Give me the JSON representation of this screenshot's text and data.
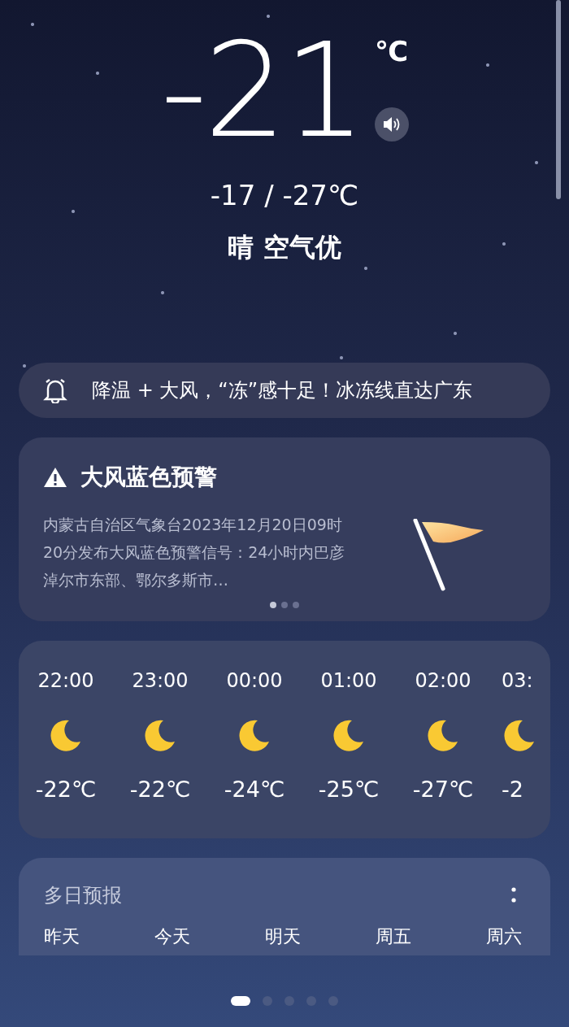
{
  "current": {
    "temperature": "-21",
    "unit": "℃",
    "range": "-17 / -27℃",
    "condition": "晴 空气优"
  },
  "news": {
    "text": "降温 + 大风，“冻”感十足！冰冻线直达广东"
  },
  "warning": {
    "title": "大风蓝色预警",
    "body": "内蒙古自治区气象台2023年12月20日09时20分发布大风蓝色预警信号：24小时内巴彦淖尔市东部、鄂尔多斯市…",
    "pages": [
      {
        "selected": true
      },
      {
        "selected": false
      },
      {
        "selected": false
      }
    ]
  },
  "hourly": [
    {
      "time": "22:00",
      "temp": "-22℃",
      "kind": "full"
    },
    {
      "time": "23:00",
      "temp": "-22℃",
      "kind": "full"
    },
    {
      "time": "00:00",
      "temp": "-24℃",
      "kind": "full"
    },
    {
      "time": "01:00",
      "temp": "-25℃",
      "kind": "full"
    },
    {
      "time": "02:00",
      "temp": "-27℃",
      "kind": "full"
    },
    {
      "time": "03:",
      "temp": "-2",
      "kind": "partial"
    }
  ],
  "forecast": {
    "title": "多日预报",
    "days": [
      "昨天",
      "今天",
      "明天",
      "周五",
      "周六"
    ]
  },
  "pages": [
    {
      "selected": true
    },
    {
      "selected": false
    },
    {
      "selected": false
    },
    {
      "selected": false
    },
    {
      "selected": false
    }
  ]
}
